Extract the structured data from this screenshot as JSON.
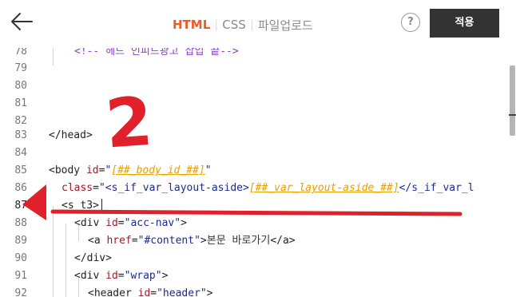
{
  "header": {
    "tabs": [
      {
        "label": "HTML",
        "active": true
      },
      {
        "label": "CSS",
        "active": false
      },
      {
        "label": "파일업로드",
        "active": false
      }
    ],
    "help_label": "?",
    "apply_label": "적용"
  },
  "editor": {
    "current_line": 87,
    "lines": [
      {
        "no": "78",
        "text": "    <!-- 헤드 인피드광고 삽입 끝-->"
      },
      {
        "no": "79",
        "text": ""
      },
      {
        "no": "80",
        "text": ""
      },
      {
        "no": "81",
        "text": ""
      },
      {
        "no": "82",
        "text": ""
      },
      {
        "no": "83",
        "text": "</head>"
      },
      {
        "no": "84",
        "text": ""
      },
      {
        "no": "85",
        "text": "<body id=\"[##_body_id_##]\""
      },
      {
        "no": "86",
        "text": "  class=\"<s_if_var_layout-aside>[##_var_layout-aside_##]</s_if_var_l"
      },
      {
        "no": "87",
        "text": "  <s_t3>"
      },
      {
        "no": "88",
        "text": "    <div id=\"acc-nav\">"
      },
      {
        "no": "89",
        "text": "      <a href=\"#content\">본문 바로가기</a>"
      },
      {
        "no": "90",
        "text": "    </div>"
      },
      {
        "no": "91",
        "text": "    <div id=\"wrap\">"
      },
      {
        "no": "92",
        "text": "      <header id=\"header\">"
      }
    ],
    "tokens": {
      "l78": "<!-- 헤드 인피드광고 삽입 끝-->",
      "l83": "</head>",
      "l85_tag": "<body ",
      "l85_attr": "id",
      "l85_eq": "=",
      "l85_q1": "\"",
      "l85_var": "[##_body_id_##]",
      "l85_q2": "\"",
      "l86_attr": "class",
      "l86_eq": "=",
      "l86_str": "\"<s_if_var_layout-aside>",
      "l86_var": "[##_var_layout-aside_##]",
      "l86_str2": "</s_if_var_l",
      "l87": "<s_t3>",
      "l88_tag": "<div ",
      "l88_attr": "id",
      "l88_eq": "=",
      "l88_str": "\"acc-nav\"",
      "l88_close": ">",
      "l89_tag": "<a ",
      "l89_attr": "href",
      "l89_eq": "=",
      "l89_str": "\"#content\"",
      "l89_gt": ">",
      "l89_text": "본문 바로가기",
      "l89_end": "</a>",
      "l90": "</div>",
      "l91_tag": "<div ",
      "l91_attr": "id",
      "l91_eq": "=",
      "l91_str": "\"wrap\"",
      "l91_close": ">",
      "l92_tag": "<header ",
      "l92_attr": "id",
      "l92_eq": "=",
      "l92_str": "\"header\"",
      "l92_close": ">"
    }
  },
  "annotation": {
    "number": "2",
    "color": "#e0202a"
  },
  "colors": {
    "accent": "#f05a28",
    "apply_bg": "#333333",
    "annotation": "#e0202a"
  },
  "icons": {
    "back": "arrow-left-icon",
    "help": "question-circle-icon"
  }
}
